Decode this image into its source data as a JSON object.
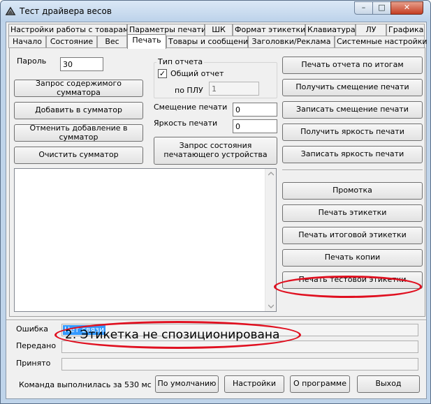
{
  "window": {
    "title": "Тест драйвера весов",
    "caption_min": "–",
    "caption_max": "□",
    "caption_close": "✕"
  },
  "tabs_row1": [
    {
      "label": "Настройки работы с товарами"
    },
    {
      "label": "Параметры печати"
    },
    {
      "label": "ШК"
    },
    {
      "label": "Формат этикетки"
    },
    {
      "label": "Клавиатура"
    },
    {
      "label": "ЛУ"
    },
    {
      "label": "Графика"
    }
  ],
  "tabs_row2": [
    {
      "label": "Начало"
    },
    {
      "label": "Состояние"
    },
    {
      "label": "Вес"
    },
    {
      "label": "Печать",
      "active": true
    },
    {
      "label": "Товары и сообщения"
    },
    {
      "label": "Заголовки/Реклама"
    },
    {
      "label": "Системные настройки"
    }
  ],
  "print_page": {
    "password_label": "Пароль",
    "password_value": "30",
    "left_buttons": [
      "Запрос содержимого сумматора",
      "Добавить в сумматор",
      "Отменить добавление в сумматор",
      "Очистить сумматор"
    ],
    "report_type_title": "Тип отчета",
    "general_report_label": "Общий отчет",
    "general_report_checked": true,
    "check_mark": "✓",
    "by_plu_label": "по ПЛУ",
    "by_plu_value": "1",
    "print_offset_label": "Смещение печати",
    "print_offset_value": "0",
    "brightness_label": "Яркость печати",
    "brightness_value": "0",
    "printer_status_button": "Запрос состояния печатающего устройства",
    "right_buttons_top": [
      "Печать отчета по итогам",
      "Получить смещение печати",
      "Записать смещение печати",
      "Получить яркость печати",
      "Записать яркость печати"
    ],
    "right_buttons_bottom": [
      "Промотка",
      "Печать этикетки",
      "Печать итоговой этикетки",
      "Печать копии",
      "Печать тестовой этикетки"
    ]
  },
  "status": {
    "error_label": "Ошибка",
    "error_value": "Нет связи",
    "sent_label": "Передано",
    "received_label": "Принято",
    "command_time": "Команда выполнилась за 530 мс"
  },
  "bottom_buttons": [
    "По умолчанию",
    "Настройки",
    "О программе",
    "Выход"
  ],
  "annotation": {
    "text": "2. Этикетка не спозиционирована",
    "color": "#e01020"
  }
}
